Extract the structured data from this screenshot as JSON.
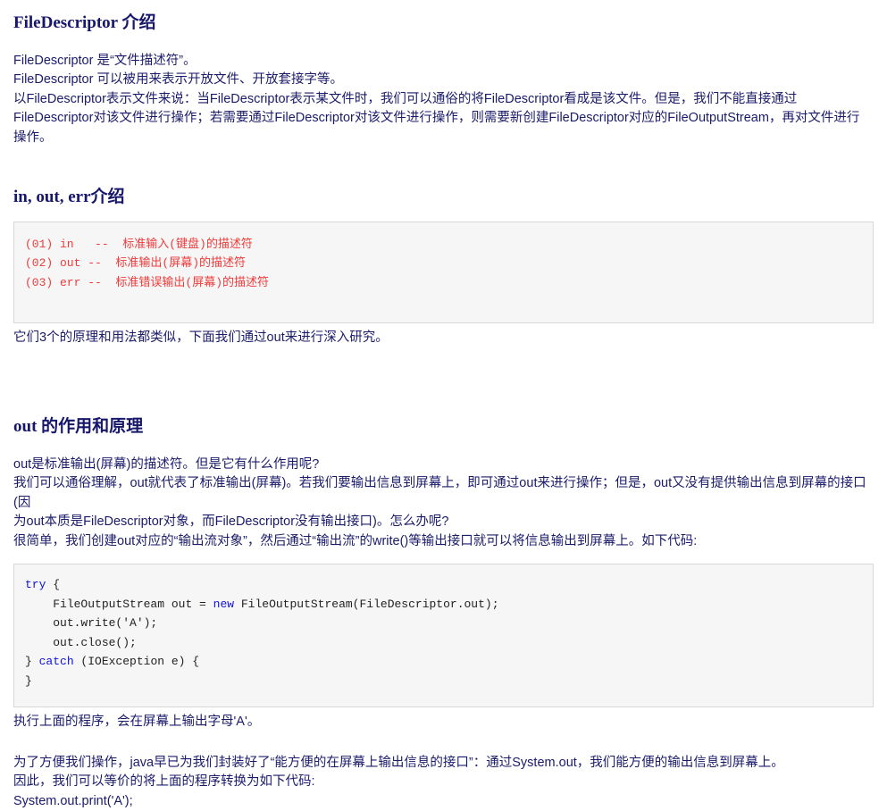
{
  "document": {
    "sections": [
      {
        "id": "filedescriptor-intro",
        "heading": "FileDescriptor 介绍",
        "paragraph": "FileDescriptor 是“文件描述符”。\nFileDescriptor 可以被用来表示开放文件、开放套接字等。\n以FileDescriptor表示文件来说：当FileDescriptor表示某文件时，我们可以通俗的将FileDescriptor看成是该文件。但是，我们不能直接通过\nFileDescriptor对该文件进行操作；若需要通过FileDescriptor对该文件进行操作，则需要新创建FileDescriptor对应的FileOutputStream，再对文件进行\n操作。"
      },
      {
        "id": "in-out-err-intro",
        "heading": "in, out, err介绍",
        "code": "(01) in   --  标准输入(键盘)的描述符\n(02) out --  标准输出(屏幕)的描述符\n(03) err --  标准错误输出(屏幕)的描述符",
        "after_code": "它们3个的原理和用法都类似，下面我们通过out来进行深入研究。"
      },
      {
        "id": "out-principle",
        "heading": "out 的作用和原理",
        "paragraph": "out是标准输出(屏幕)的描述符。但是它有什么作用呢?\n我们可以通俗理解，out就代表了标准输出(屏幕)。若我们要输出信息到屏幕上，即可通过out来进行操作；但是，out又没有提供输出信息到屏幕的接口(因\n为out本质是FileDescriptor对象，而FileDescriptor没有输出接口)。怎么办呢?\n很简单，我们创建out对应的“输出流对象”，然后通过“输出流”的write()等输出接口就可以将信息输出到屏幕上。如下代码:",
        "code_lines": [
          {
            "indent": 0,
            "parts": [
              {
                "t": "try",
                "c": "kw"
              },
              {
                "t": " {",
                "c": "cd"
              }
            ]
          },
          {
            "indent": 1,
            "parts": [
              {
                "t": "FileOutputStream out = ",
                "c": "cd"
              },
              {
                "t": "new",
                "c": "kw"
              },
              {
                "t": " FileOutputStream(FileDescriptor.out);",
                "c": "cd"
              }
            ]
          },
          {
            "indent": 1,
            "parts": [
              {
                "t": "out.write('A');",
                "c": "cd"
              }
            ]
          },
          {
            "indent": 1,
            "parts": [
              {
                "t": "out.close();",
                "c": "cd"
              }
            ]
          },
          {
            "indent": 0,
            "parts": [
              {
                "t": "} ",
                "c": "cd"
              },
              {
                "t": "catch",
                "c": "kw"
              },
              {
                "t": " (IOException e) {",
                "c": "cd"
              }
            ]
          },
          {
            "indent": 0,
            "parts": [
              {
                "t": "}",
                "c": "cd"
              }
            ]
          }
        ],
        "after_code": "执行上面的程序，会在屏幕上输出字母'A'。",
        "closing": "为了方便我们操作，java早已为我们封装好了“能方便的在屏幕上输出信息的接口”：通过System.out，我们能方便的输出信息到屏幕上。\n因此，我们可以等价的将上面的程序转换为如下代码:\nSystem.out.print('A');"
      }
    ]
  },
  "colors": {
    "heading": "#16166b",
    "body_text": "#1b1b6b",
    "code_red": "#ee3b3b",
    "code_keyword": "#1111dd",
    "code_bg": "#f6f6f6",
    "code_border": "#d8d8d8",
    "page_bg": "#ffffff"
  }
}
